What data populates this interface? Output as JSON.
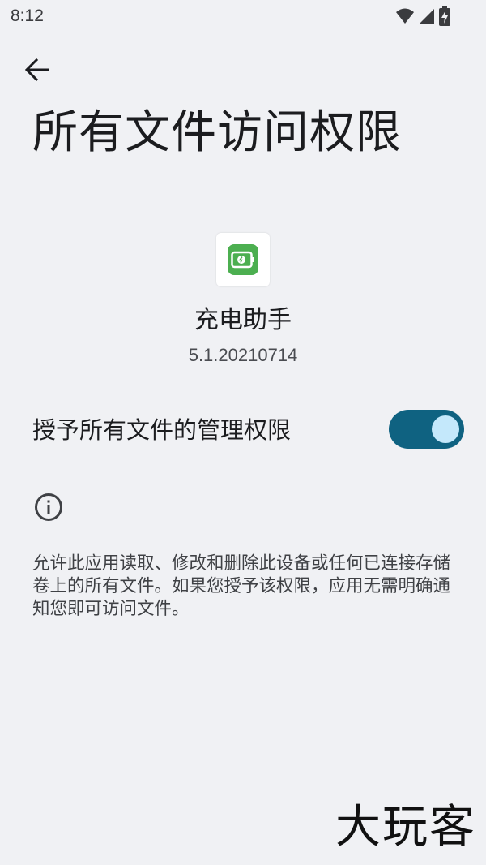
{
  "status_bar": {
    "time": "8:12",
    "icons": [
      "wifi-icon",
      "cellular-signal-icon",
      "battery-charging-icon"
    ]
  },
  "header": {
    "back_icon": "arrow-back-icon",
    "title": "所有文件访问权限"
  },
  "app": {
    "icon": "charger-app-icon",
    "icon_color": "#4caf50",
    "name": "充电助手",
    "version": "5.1.20210714"
  },
  "permission_toggle": {
    "label": "授予所有文件的管理权限",
    "checked": true,
    "track_color": "#0f6281",
    "thumb_color": "#c4e8fb"
  },
  "info": {
    "icon": "info-icon",
    "description": "允许此应用读取、修改和删除此设备或任何已连接存储卷上的所有文件。如果您授予该权限，应用无需明确通知您即可访问文件。"
  },
  "watermark": {
    "text": "大玩客"
  }
}
